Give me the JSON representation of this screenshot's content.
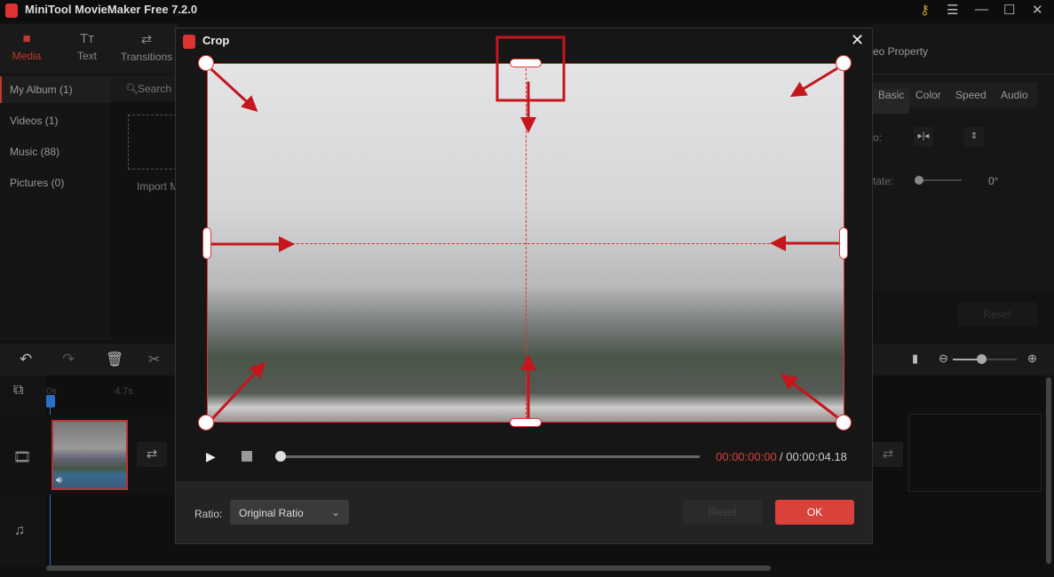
{
  "app": {
    "title": "MiniTool MovieMaker Free 7.2.0"
  },
  "window_controls": {
    "key": "key-icon",
    "menu": "menu-icon",
    "minimize": "minimize-icon",
    "maximize": "maximize-icon",
    "close": "close-icon"
  },
  "topnav": [
    {
      "label": "Media",
      "icon": "folder-icon",
      "active": true
    },
    {
      "label": "Text",
      "icon": "text-icon"
    },
    {
      "label": "Transitions",
      "icon": "transitions-icon"
    }
  ],
  "sidebar": {
    "items": [
      "My Album (1)",
      "Videos (1)",
      "Music (88)",
      "Pictures (0)"
    ],
    "search_placeholder": "Search m",
    "import_label": "Import M"
  },
  "right_panel": {
    "title": "eo Property",
    "tabs": [
      "Basic",
      "Color",
      "Speed",
      "Audio"
    ],
    "flip_label": "o:",
    "rotate_label": "tate:",
    "rotate_value": "0°",
    "reset_label": "Reset"
  },
  "timeline": {
    "time_start": "0s",
    "time_mark": "4.7s",
    "zoom_level": 0.45
  },
  "dialog": {
    "title": "Crop",
    "current_time": "00:00:00:00",
    "total_time": "/ 00:00:04.18",
    "ratio_label": "Ratio:",
    "ratio_value": "Original Ratio",
    "reset_label": "Reset",
    "ok_label": "OK",
    "progress": 0
  },
  "colors": {
    "accent": "#d9413b",
    "background": "#111111"
  }
}
